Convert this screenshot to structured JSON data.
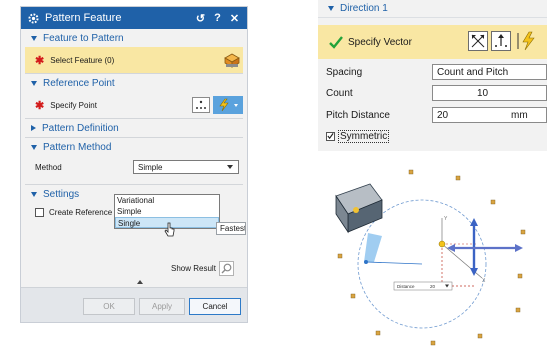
{
  "dialog": {
    "title": "Pattern Feature",
    "title_buttons": {
      "reset": "↺",
      "help": "?",
      "close": "✕"
    },
    "feature_section": {
      "label": "Feature to Pattern",
      "select_label": "Select Feature (0)"
    },
    "reference_section": {
      "label": "Reference Point",
      "specify_label": "Specify Point"
    },
    "definition_section": {
      "label": "Pattern Definition"
    },
    "method_section": {
      "label": "Pattern Method",
      "method_label": "Method",
      "selected": "Simple",
      "options": [
        "Variational",
        "Simple",
        "Single"
      ],
      "highlighted_option": "Single",
      "tooltip": "Fastest"
    },
    "settings_section": {
      "label": "Settings",
      "checkbox_label": "Create Reference Patterns"
    },
    "show_result": "Show Result",
    "buttons": {
      "ok": "OK",
      "apply": "Apply",
      "cancel": "Cancel"
    }
  },
  "direction_panel": {
    "header": "Direction 1",
    "specify_vector": "Specify Vector",
    "spacing_label": "Spacing",
    "spacing_value": "Count and Pitch",
    "count_label": "Count",
    "count_value": "10",
    "pitch_label": "Pitch Distance",
    "pitch_value": "20",
    "pitch_unit": "mm",
    "symmetric_label": "Symmetric",
    "symmetric_checked": true
  },
  "viewport": {
    "axis_labels": {
      "x": "X",
      "y": "Y"
    },
    "input_label": "Distance",
    "input_value": "20"
  },
  "colors": {
    "accent": "#1f61a8",
    "selection_highlight": "#f9e7a3",
    "required_star": "#d31c1c",
    "check_green": "#22a33a"
  }
}
